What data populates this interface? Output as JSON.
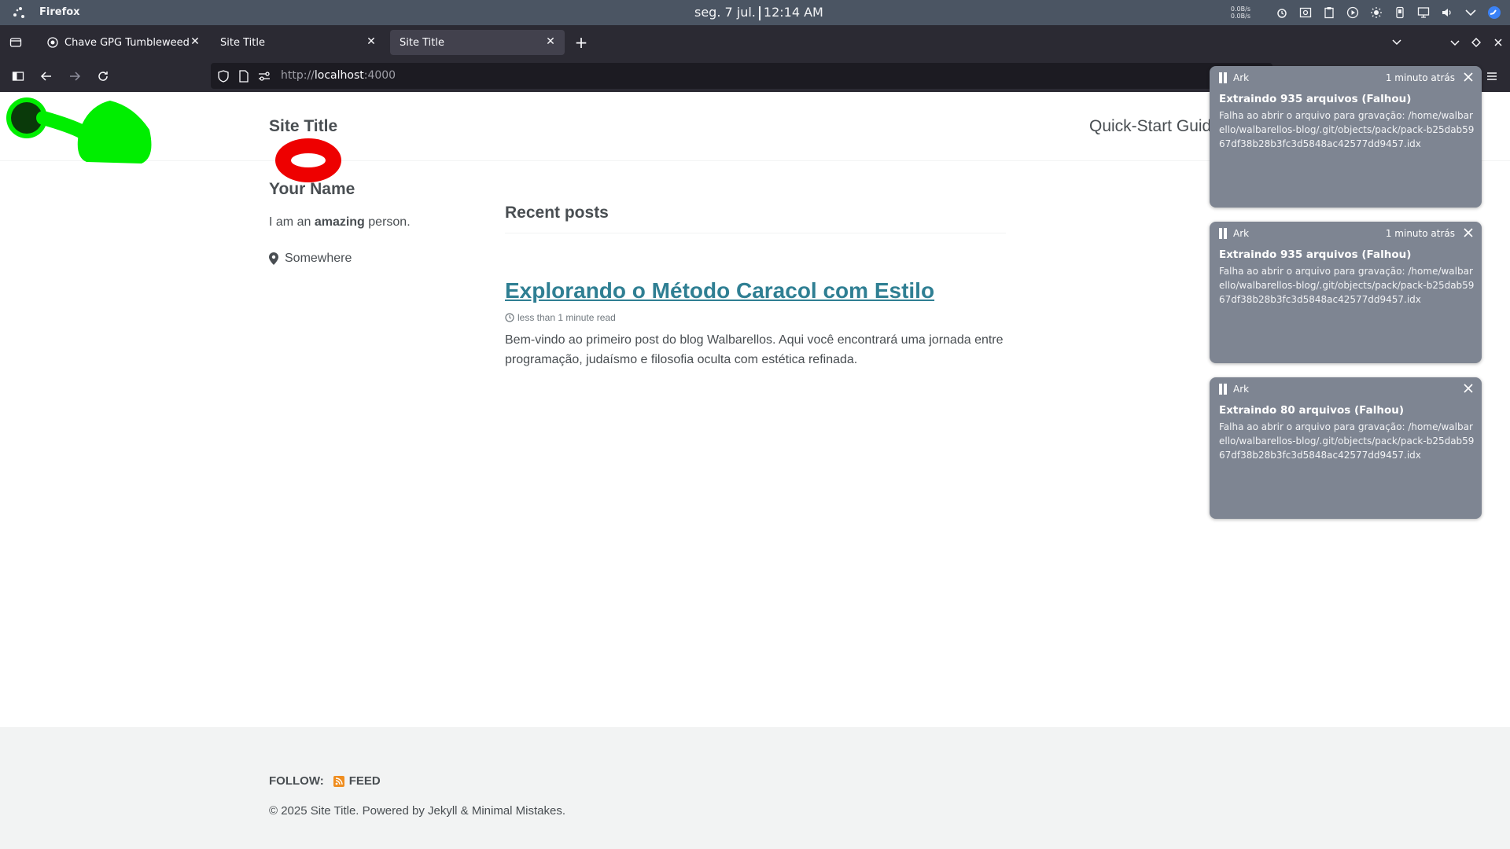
{
  "system": {
    "app_name": "Firefox",
    "clock_date": "seg. 7 jul.",
    "clock_time": "12:14 AM",
    "net_up": "0.0B/s",
    "net_down": "0.0B/s",
    "tray_icons": [
      "alarm-icon",
      "screenshot-icon",
      "clipboard-icon",
      "media-play-icon",
      "brightness-icon",
      "phone-icon",
      "display-icon",
      "volume-icon",
      "chevron-down-icon",
      "steam-icon"
    ]
  },
  "browser": {
    "tabs": [
      {
        "label": "Chave GPG Tumbleweed",
        "active": false
      },
      {
        "label": "Site Title",
        "active": false
      },
      {
        "label": "Site Title",
        "active": true
      }
    ],
    "new_tab_label": "+",
    "url_scheme": "http://",
    "url_host": "localhost",
    "url_port": ":4000"
  },
  "page": {
    "site_title": "Site Title",
    "nav_link": "Quick-Start Guide",
    "author": {
      "name": "Your Name",
      "bio_prefix": "I am an",
      "bio_bold": "amazing",
      "bio_suffix": "person.",
      "location": "Somewhere"
    },
    "recent_title": "Recent posts",
    "post": {
      "title": "Explorando o Método Caracol com Estilo",
      "meta": "less than 1 minute read",
      "excerpt": "Bem-vindo ao primeiro post do blog Walbarellos. Aqui você encontrará uma jornada entre programação, judaísmo e filosofia oculta com estética refinada."
    },
    "footer": {
      "follow_label": "FOLLOW:",
      "feed_label": "FEED",
      "copyright": "© 2025 Site Title. Powered by Jekyll & Minimal Mistakes."
    }
  },
  "notifications": [
    {
      "app": "Ark",
      "time": "1 minuto atrás",
      "title": "Extraindo 935 arquivos (Falhou)",
      "body": "Falha ao abrir o arquivo para gravação: /home/walbarello/walbarellos-blog/.git/objects/pack/pack-b25dab5967df38b28b3fc3d5848ac42577dd9457.idx"
    },
    {
      "app": "Ark",
      "time": "1 minuto atrás",
      "title": "Extraindo 935 arquivos (Falhou)",
      "body": "Falha ao abrir o arquivo para gravação: /home/walbarello/walbarellos-blog/.git/objects/pack/pack-b25dab5967df38b28b3fc3d5848ac42577dd9457.idx"
    },
    {
      "app": "Ark",
      "time": "",
      "title": "Extraindo 80 arquivos (Falhou)",
      "body": "Falha ao abrir o arquivo para gravação: /home/walbarello/walbarellos-blog/.git/objects/pack/pack-b25dab5967df38b28b3fc3d5848ac42577dd9457.idx"
    }
  ],
  "colors": {
    "link": "#2f7f93",
    "notification_bg": "#7e8592",
    "annotation_green": "#00ee00",
    "annotation_red": "#ee0000"
  }
}
